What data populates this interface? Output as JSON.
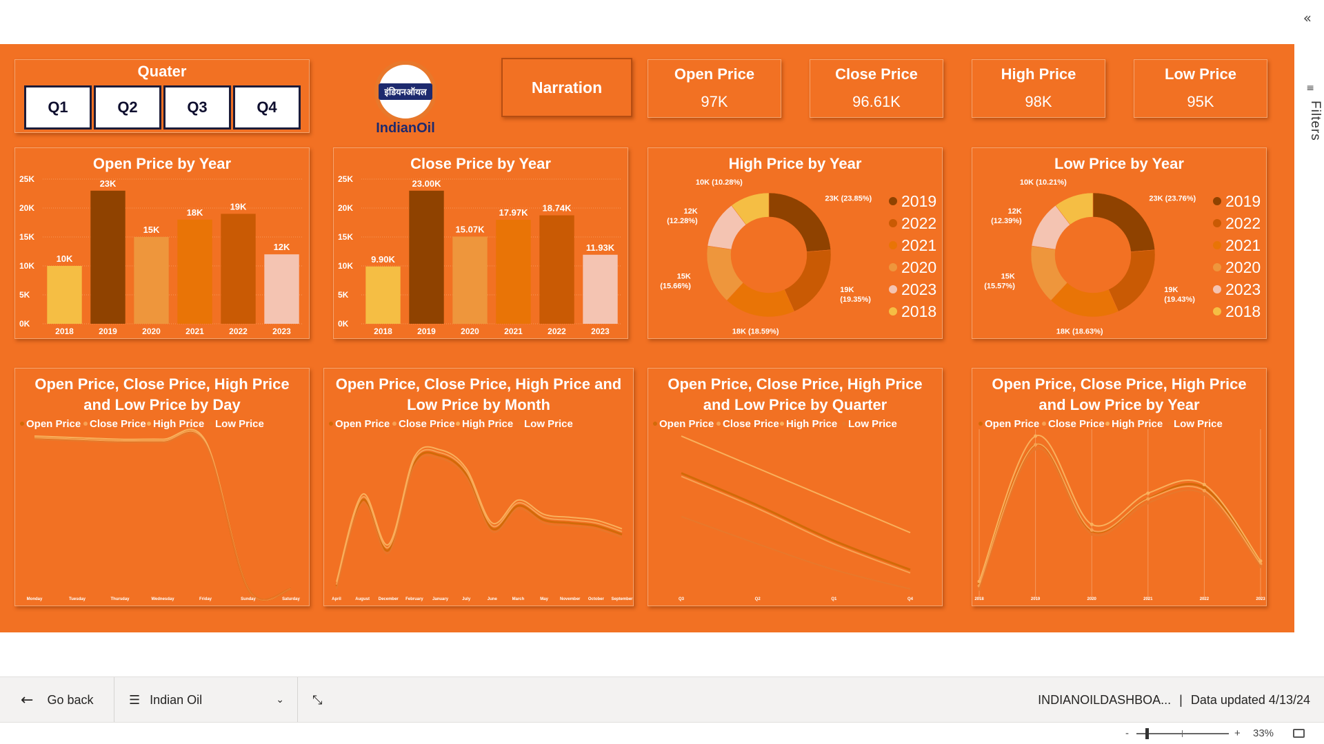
{
  "window": {
    "collapse_glyph": "«",
    "filters_glyph": "≡",
    "filters_label": "Filters"
  },
  "slicer": {
    "title": "Quater",
    "options": [
      "Q1",
      "Q2",
      "Q3",
      "Q4"
    ]
  },
  "logo": {
    "hindi_text": "इंडियनऑयल",
    "brand_text": "IndianOil",
    "colors": {
      "ring": "#e8782b",
      "band": "#1d2a6e",
      "text": "#1d2a6e"
    }
  },
  "narration": {
    "label": "Narration"
  },
  "kpis": [
    {
      "label": "Open Price",
      "value": "97K"
    },
    {
      "label": "Close Price",
      "value": "96.61K"
    },
    {
      "label": "High Price",
      "value": "98K"
    },
    {
      "label": "Low Price",
      "value": "95K"
    }
  ],
  "colors": {
    "background": "#f27123",
    "y2018": "#f5be44",
    "y2019": "#8f4200",
    "y2020": "#ee963c",
    "y2021": "#e97406",
    "y2022": "#c95a04",
    "y2023": "#f4c4b2"
  },
  "chart_data": [
    {
      "type": "bar",
      "title": "Open Price by Year",
      "categories": [
        "2018",
        "2019",
        "2020",
        "2021",
        "2022",
        "2023"
      ],
      "values": [
        10000,
        23000,
        15000,
        18000,
        19000,
        12000
      ],
      "data_labels": [
        "10K",
        "23K",
        "15K",
        "18K",
        "19K",
        "12K"
      ],
      "yticks": [
        "0K",
        "5K",
        "10K",
        "15K",
        "20K",
        "25K"
      ],
      "ylim": [
        0,
        25000
      ]
    },
    {
      "type": "bar",
      "title": "Close Price by Year",
      "categories": [
        "2018",
        "2019",
        "2020",
        "2021",
        "2022",
        "2023"
      ],
      "values": [
        9900,
        23000,
        15070,
        17970,
        18740,
        11930
      ],
      "data_labels": [
        "9.90K",
        "23.00K",
        "15.07K",
        "17.97K",
        "18.74K",
        "11.93K"
      ],
      "yticks": [
        "0K",
        "5K",
        "10K",
        "15K",
        "20K",
        "25K"
      ],
      "ylim": [
        0,
        25000
      ]
    },
    {
      "type": "pie",
      "title": "High Price by Year",
      "order": [
        "2019",
        "2022",
        "2021",
        "2020",
        "2023",
        "2018"
      ],
      "values": [
        23000,
        19000,
        18000,
        15000,
        12000,
        10000
      ],
      "labels": [
        "23K (23.85%)",
        "19K\n(19.35%)",
        "18K (18.59%)",
        "15K\n(15.66%)",
        "12K\n(12.28%)",
        "10K (10.28%)"
      ],
      "legend": [
        "2019",
        "2022",
        "2021",
        "2020",
        "2023",
        "2018"
      ]
    },
    {
      "type": "pie",
      "title": "Low Price by Year",
      "order": [
        "2019",
        "2022",
        "2021",
        "2020",
        "2023",
        "2018"
      ],
      "values": [
        23000,
        19000,
        18000,
        15000,
        12000,
        10000
      ],
      "labels": [
        "23K (23.76%)",
        "19K\n(19.43%)",
        "18K (18.63%)",
        "15K\n(15.57%)",
        "12K\n(12.39%)",
        "10K (10.21%)"
      ],
      "legend": [
        "2019",
        "2022",
        "2021",
        "2020",
        "2023",
        "2018"
      ]
    },
    {
      "type": "line",
      "title": "Open Price, Close Price, High Price and Low Price by Day",
      "legend": [
        "Open Price",
        "Close Price",
        "High Price",
        "Low Price"
      ],
      "x": [
        "Monday",
        "Tuesday",
        "Thursday",
        "Wednesday",
        "Friday",
        "Sunday",
        "Saturday"
      ],
      "series": [
        {
          "name": "Open Price",
          "values": [
            97,
            96,
            95,
            95,
            94,
            2,
            2
          ]
        },
        {
          "name": "Close Price",
          "values": [
            97,
            96,
            95,
            95,
            94,
            2,
            2
          ]
        },
        {
          "name": "High Price",
          "values": [
            98,
            97,
            96,
            96,
            95,
            2,
            2
          ]
        },
        {
          "name": "Low Price",
          "values": [
            96,
            95,
            94,
            94,
            93,
            2,
            2
          ]
        }
      ]
    },
    {
      "type": "line",
      "title": "Open Price, Close Price, High Price and Low Price by Month",
      "legend": [
        "Open Price",
        "Close Price",
        "High Price",
        "Low Price"
      ],
      "x": [
        "April",
        "August",
        "December",
        "February",
        "January",
        "July",
        "June",
        "March",
        "May",
        "November",
        "October",
        "September"
      ],
      "series": [
        {
          "name": "Open Price",
          "values": [
            2,
            62,
            27,
            88,
            93,
            80,
            42,
            58,
            48,
            46,
            44,
            38
          ]
        },
        {
          "name": "Close Price",
          "values": [
            3,
            64,
            29,
            90,
            95,
            82,
            44,
            60,
            50,
            48,
            46,
            40
          ]
        },
        {
          "name": "High Price",
          "values": [
            5,
            66,
            31,
            92,
            97,
            84,
            46,
            62,
            52,
            50,
            48,
            42
          ]
        },
        {
          "name": "Low Price",
          "values": [
            0,
            60,
            25,
            86,
            91,
            78,
            40,
            56,
            46,
            44,
            42,
            36
          ]
        }
      ]
    },
    {
      "type": "line",
      "title": "Open Price, Close Price, High Price and Low Price by Quarter",
      "legend": [
        "Open Price",
        "Close Price",
        "High Price",
        "Low Price"
      ],
      "x": [
        "Q3",
        "Q2",
        "Q1",
        "Q4"
      ],
      "series": [
        {
          "name": "Open Price",
          "values": [
            72,
            52,
            30,
            12
          ]
        },
        {
          "name": "Close Price",
          "values": [
            70,
            50,
            28,
            10
          ]
        },
        {
          "name": "High Price",
          "values": [
            95,
            75,
            55,
            35
          ]
        },
        {
          "name": "Low Price",
          "values": [
            45,
            28,
            12,
            0
          ]
        }
      ]
    },
    {
      "type": "line",
      "title": "Open Price, Close Price, High Price and Low Price by Year",
      "legend": [
        "Open Price",
        "Close Price",
        "High Price",
        "Low Price"
      ],
      "x": [
        "2018",
        "2019",
        "2020",
        "2021",
        "2022",
        "2023"
      ],
      "series": [
        {
          "name": "Open Price",
          "values": [
            10,
            23,
            15,
            18,
            19,
            12
          ]
        },
        {
          "name": "Close Price",
          "values": [
            9.9,
            23,
            15.07,
            17.97,
            18.74,
            11.93
          ]
        },
        {
          "name": "High Price",
          "values": [
            10.3,
            23.8,
            15.6,
            18.5,
            19.3,
            12.2
          ]
        },
        {
          "name": "Low Price",
          "values": [
            9.6,
            22.6,
            14.7,
            17.6,
            18.4,
            11.7
          ]
        }
      ]
    }
  ],
  "bottombar": {
    "go_back": "Go back",
    "page_name": "Indian Oil",
    "report_name": "INDIANOILDASHBOA...",
    "separator": "|",
    "data_updated": "Data updated 4/13/24"
  },
  "statusbar": {
    "zoom_minus": "-",
    "zoom_plus": "+",
    "zoom_level": "33%",
    "zoom_fraction": 0.33
  }
}
